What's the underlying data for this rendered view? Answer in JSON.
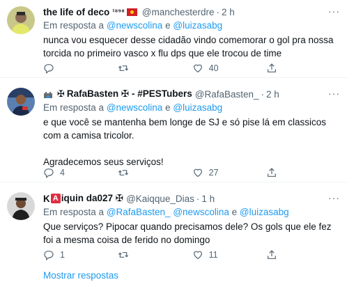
{
  "tweets": [
    {
      "name": "the life of deco",
      "name_suffix": "¹⁸⁹⁸",
      "handle": "@manchesterdre",
      "time": "2 h",
      "reply_label": "Em resposta a",
      "mentions": [
        "@newscolina",
        "@luizasabg"
      ],
      "mention_joiner": "e",
      "text": "nunca vou esquecer desse cidadão vindo comemorar o gol pra nossa torcida no primeiro vasco x flu dps que ele trocou de time",
      "replies": "",
      "retweets": "",
      "likes": "40"
    },
    {
      "name_prefix": "✠",
      "name": "RafaBasten ✠ - #PESTubers",
      "handle": "@RafaBasten_",
      "time": "2 h",
      "reply_label": "Em resposta a",
      "mentions": [
        "@newscolina",
        "@luizasabg"
      ],
      "mention_joiner": "e",
      "text": "e que você se mantenha bem longe de SJ e só pise lá em classicos com a camisa tricolor.\n\nAgradecemos seus serviços!",
      "replies": "4",
      "retweets": "",
      "likes": "27"
    },
    {
      "name_start": "K",
      "name_emoji": "A",
      "name": "iquin da027 ✠",
      "handle": "@Kaiqque_Dias",
      "time": "1 h",
      "reply_label": "Em resposta a",
      "mentions": [
        "@RafaBasten_",
        "@newscolina",
        "@luizasabg"
      ],
      "mention_joiner": "e",
      "text": "Que serviços? Pipocar quando precisamos dele? Os gols que ele fez foi a mesma coisa de ferido no domingo",
      "replies": "1",
      "retweets": "",
      "likes": "11"
    }
  ],
  "more_label": "···",
  "show_replies": "Mostrar respostas",
  "icons": [
    "reply-icon",
    "retweet-icon",
    "like-icon",
    "share-icon",
    "more-icon"
  ],
  "colors": {
    "accent": "#1d9bf0",
    "muted": "#536471",
    "text": "#0f1419",
    "border": "#eff3f4"
  }
}
